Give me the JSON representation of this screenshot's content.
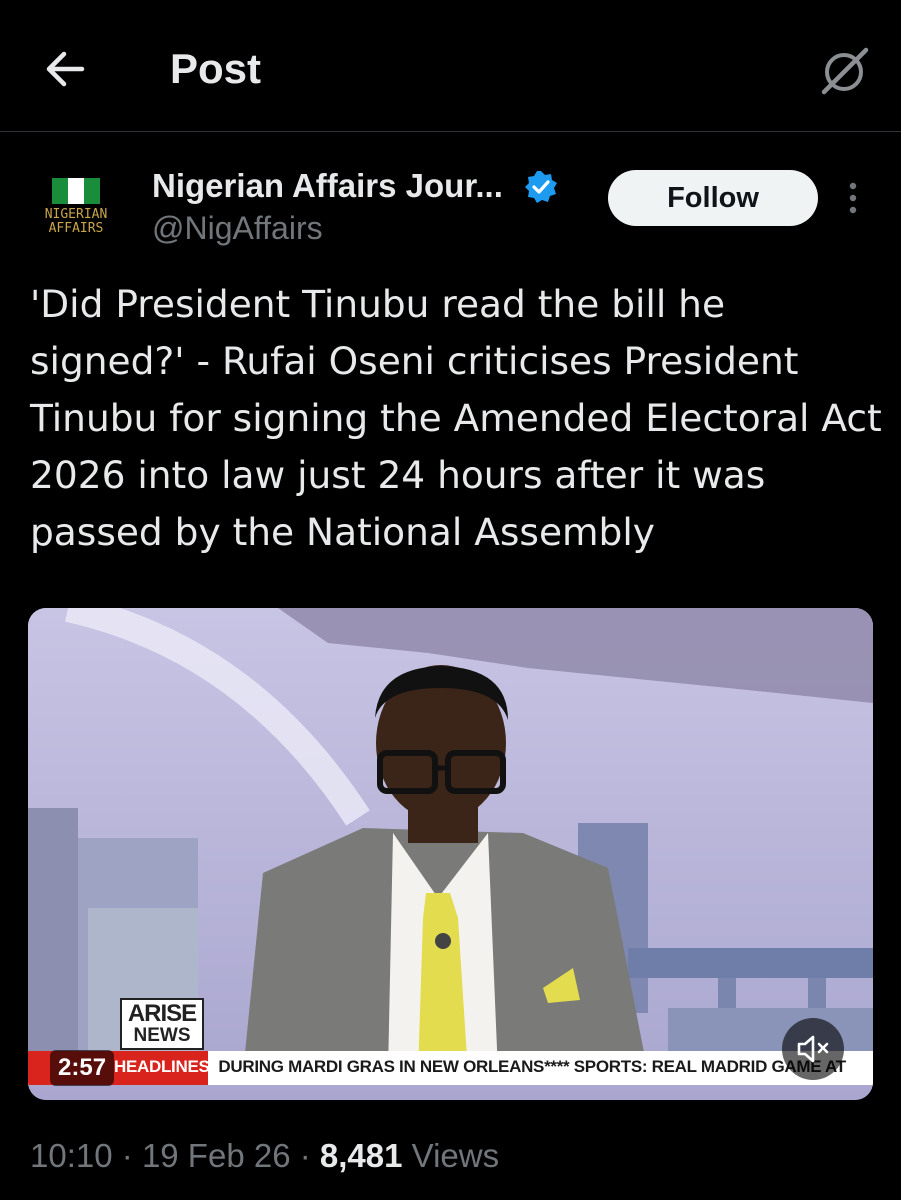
{
  "header": {
    "title": "Post",
    "back_icon": "arrow-left-icon",
    "grok_icon": "grok-icon"
  },
  "post": {
    "author": {
      "name": "Nigerian Affairs Jour...",
      "handle": "@NigAffairs",
      "verified": true,
      "avatar_text_line1": "NIGERIAN",
      "avatar_text_line2": "AFFAIRS"
    },
    "follow_label": "Follow",
    "more_icon": "more-vertical-icon",
    "text": "'Did President Tinubu read the bill he signed?' - Rufai Oseni criticises President Tinubu for signing the Amended Electoral Act 2026 into law just 24 hours after it was passed by the National Assembly",
    "video": {
      "duration": "2:57",
      "channel_logo_line1": "ARISE",
      "channel_logo_line2": "NEWS",
      "ticker_head": "HEADLINES",
      "ticker_text": "DURING MARDI GRAS IN NEW ORLEANS**** SPORTS: REAL MADRID GAME AT",
      "mute_icon": "muted-speaker-icon"
    },
    "meta": {
      "time": "10:10",
      "date": "19 Feb 26",
      "views_count": "8,481",
      "views_label": "Views",
      "separator": "·"
    }
  },
  "colors": {
    "background": "#000000",
    "text_primary": "#e7e9ea",
    "text_secondary": "#71767b",
    "verified_blue": "#1d9bf0",
    "follow_bg": "#eff3f4",
    "ticker_red": "#d9231d"
  }
}
